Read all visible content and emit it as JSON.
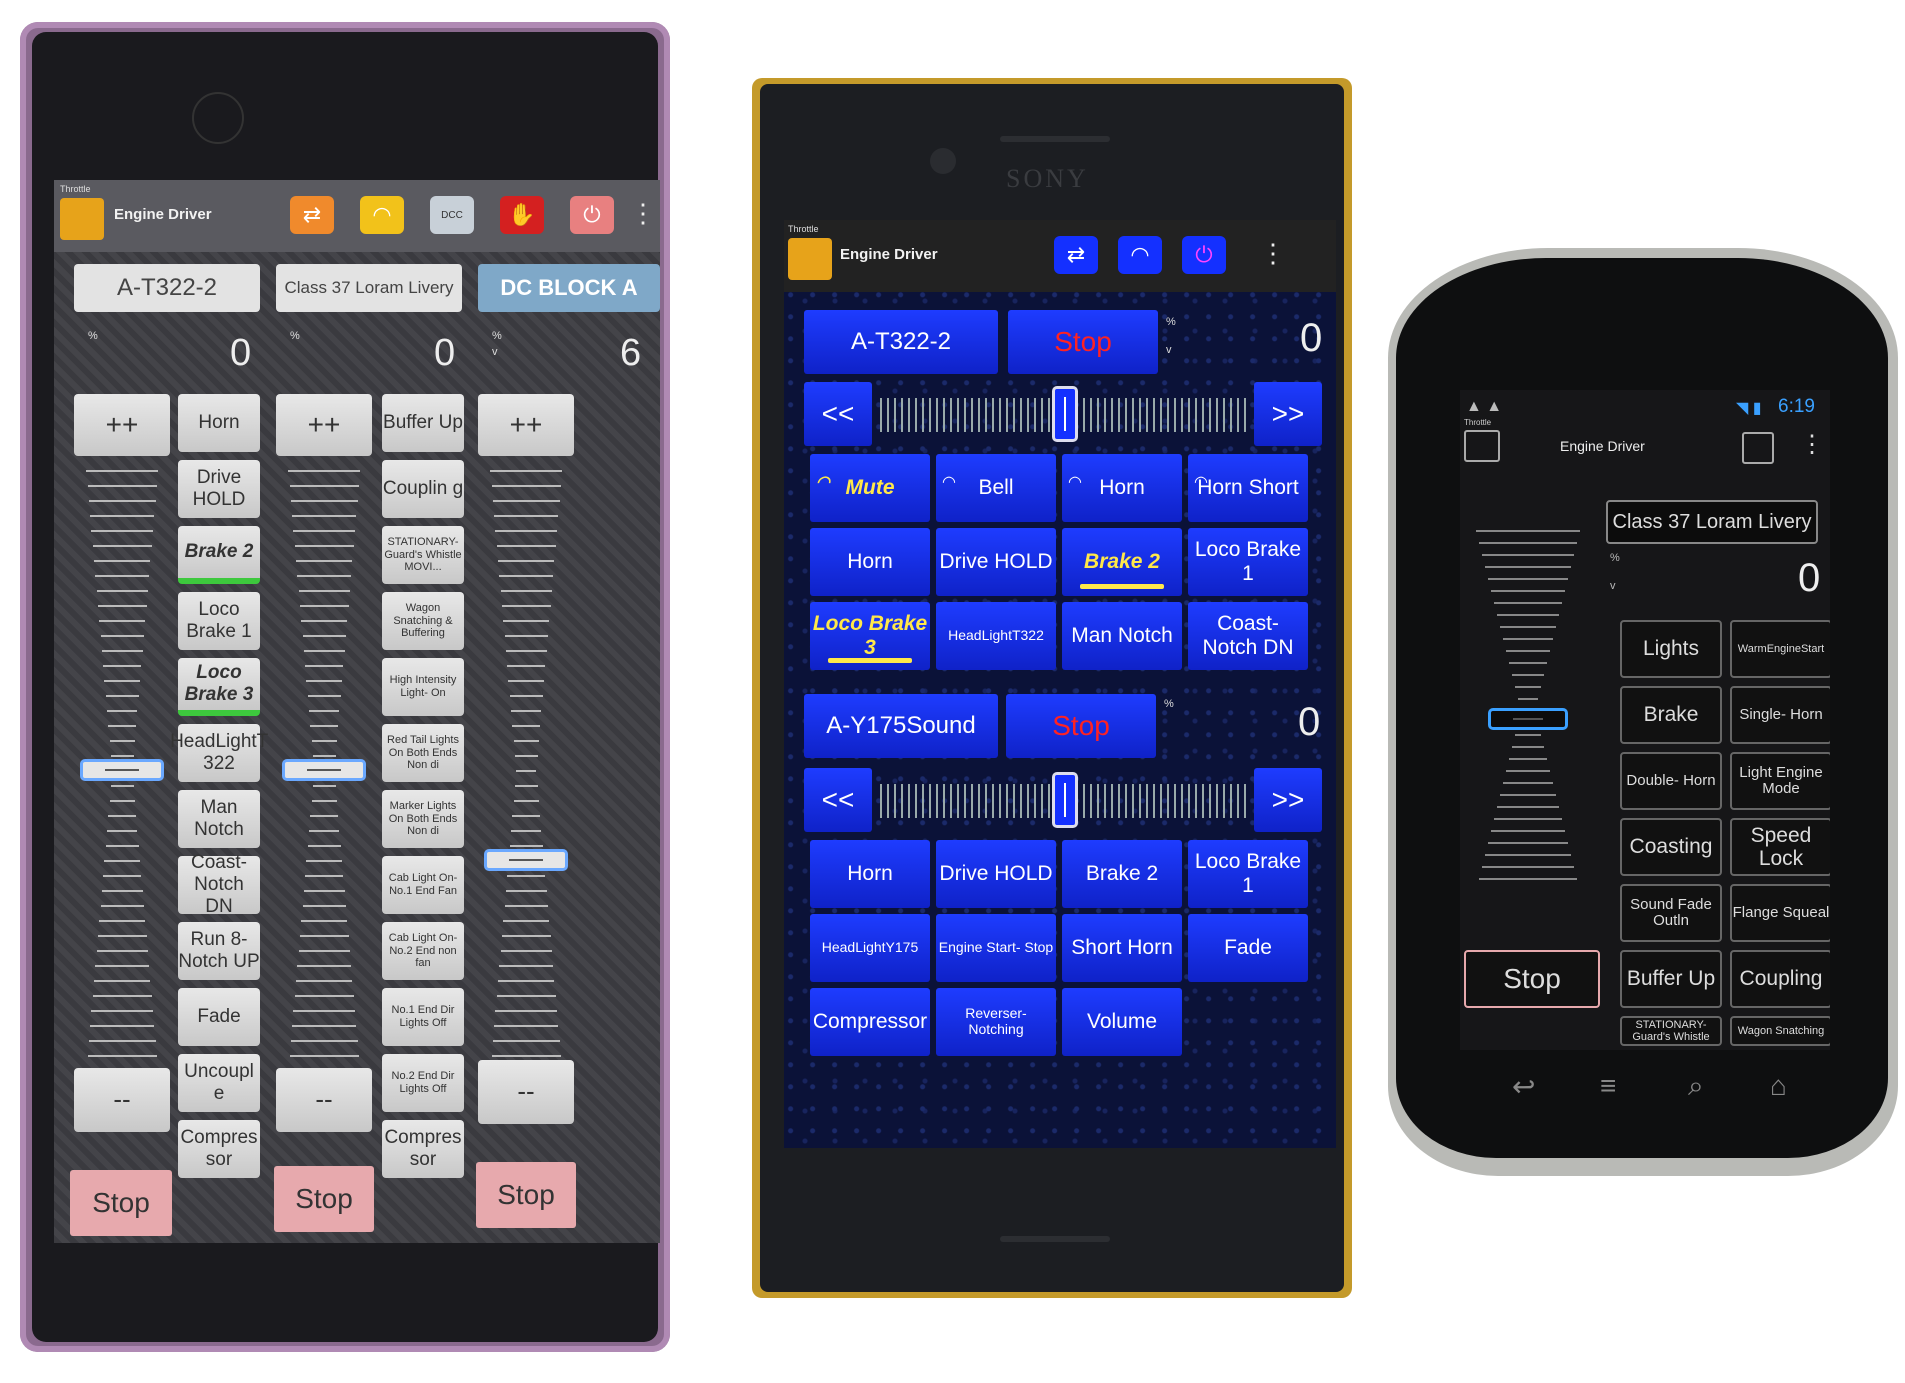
{
  "phone1": {
    "app_label": "Throttle",
    "app_title": "Engine Driver",
    "locos": [
      "A-T322-2",
      "Class 37 Loram Livery",
      "DC BLOCK A"
    ],
    "speed_unit": "%",
    "dir_unit": "v",
    "speeds": [
      "0",
      "0",
      "6"
    ],
    "inc_label": "++",
    "dec_label": "--",
    "stop_label": "Stop",
    "functions_col1": [
      "Horn",
      "Drive HOLD",
      "Brake 2",
      "Loco Brake 1",
      "Loco Brake 3",
      "HeadLightT 322",
      "Man Notch",
      "Coast- Notch DN",
      "Run 8- Notch UP",
      "Fade",
      "Uncoupl e",
      "Compres sor"
    ],
    "functions_col2": [
      "Buffer Up",
      "Couplin g",
      "STATIONARY- Guard's Whistle MOVI...",
      "Wagon Snatching & Buffering",
      "High Intensity Light- On",
      "Red Tail Lights On Both Ends Non di",
      "Marker Lights On Both Ends Non di",
      "Cab Light On- No.1 End Fan",
      "Cab Light On- No.2 End non fan",
      "No.1 End Dir Lights Off",
      "No.2 End Dir Lights Off",
      "Compres sor"
    ],
    "speed_levels": [
      0,
      0,
      6
    ],
    "icons": [
      "swap-icon",
      "headphones-icon",
      "dcc-ex-icon",
      "stop-hand-icon",
      "power-icon",
      "overflow-menu-icon"
    ]
  },
  "phone2": {
    "brand": "SONY",
    "app_label": "Throttle",
    "app_title": "Engine Driver",
    "throttles": [
      {
        "loco": "A-T322-2",
        "stop": "Stop",
        "speed": "0",
        "left": "<<",
        "right": ">>",
        "functions": [
          "Mute",
          "Bell",
          "Horn",
          "Horn Short",
          "Horn",
          "Drive HOLD",
          "Brake 2",
          "Loco Brake 1",
          "Loco Brake 3",
          "HeadLightT322",
          "Man Notch",
          "Coast- Notch DN"
        ]
      },
      {
        "loco": "A-Y175Sound",
        "stop": "Stop",
        "speed": "0",
        "left": "<<",
        "right": ">>",
        "functions": [
          "Horn",
          "Drive HOLD",
          "Brake 2",
          "Loco Brake 1",
          "HeadLightY175",
          "Engine Start- Stop",
          "Short Horn",
          "Fade",
          "Compressor",
          "Reverser- Notching",
          "Volume"
        ]
      }
    ],
    "speed_unit": "%",
    "dir_unit": "v",
    "icons": [
      "swap-icon",
      "headphones-icon",
      "power-icon",
      "overflow-menu-icon"
    ]
  },
  "phone3": {
    "status_time": "6:19",
    "app_label": "Throttle",
    "app_title": "Engine Driver",
    "loco": "Class 37 Loram Livery",
    "speed_unit": "%",
    "dir_unit": "v",
    "speed": "0",
    "stop_label": "Stop",
    "functions": [
      "Lights",
      "WarmEngineStart",
      "Brake",
      "Single- Horn",
      "Double- Horn",
      "Light Engine Mode",
      "Coasting",
      "Speed Lock",
      "Sound Fade Outln",
      "Flange Squeal",
      "Buffer Up",
      "Coupling",
      "STATIONARY- Guard's Whistle",
      "Wagon Snatching"
    ],
    "softkeys": [
      "back-icon",
      "menu-icon",
      "search-icon",
      "home-icon"
    ]
  },
  "colors": {
    "p1_bg": "#3d3d42",
    "p2_blue": "#1430ff",
    "p2_stop": "#ff2222",
    "p2_highlight": "#ffe84a",
    "p3_accent": "#3aa0ff"
  }
}
